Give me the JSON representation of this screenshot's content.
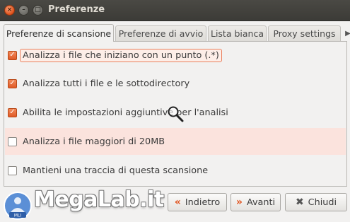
{
  "window": {
    "title": "Preferenze"
  },
  "tabs": [
    {
      "label": "Preferenze di scansione",
      "active": true
    },
    {
      "label": "Preferenze di avvio",
      "active": false
    },
    {
      "label": "Lista bianca",
      "active": false
    },
    {
      "label": "Proxy settings",
      "active": false
    }
  ],
  "options": [
    {
      "label": "Analizza i file che iniziano con un punto (.*)",
      "checked": true
    },
    {
      "label": "Analizza tutti i file e le sottodirectory",
      "checked": true
    },
    {
      "label": "Abilita le impostazioni aggiuntive per l'analisi",
      "checked": true
    },
    {
      "label": "Analizza i file maggiori di 20MB",
      "checked": false
    },
    {
      "label": "Mantieni una traccia di questa scansione",
      "checked": false
    }
  ],
  "buttons": {
    "back": "Indietro",
    "next": "Avanti",
    "close": "Chiudi"
  },
  "watermark": {
    "text": "MegaLab.it",
    "badge": "MLI"
  },
  "colors": {
    "accent": "#e0541f",
    "highlight_row": "#fbe3dd",
    "titlebar": "#3c3b37"
  },
  "icons": [
    "close-icon",
    "minimize-icon",
    "maximize-icon",
    "magnifier-cursor-icon",
    "back-arrow-icon",
    "forward-arrow-icon",
    "x-icon"
  ]
}
